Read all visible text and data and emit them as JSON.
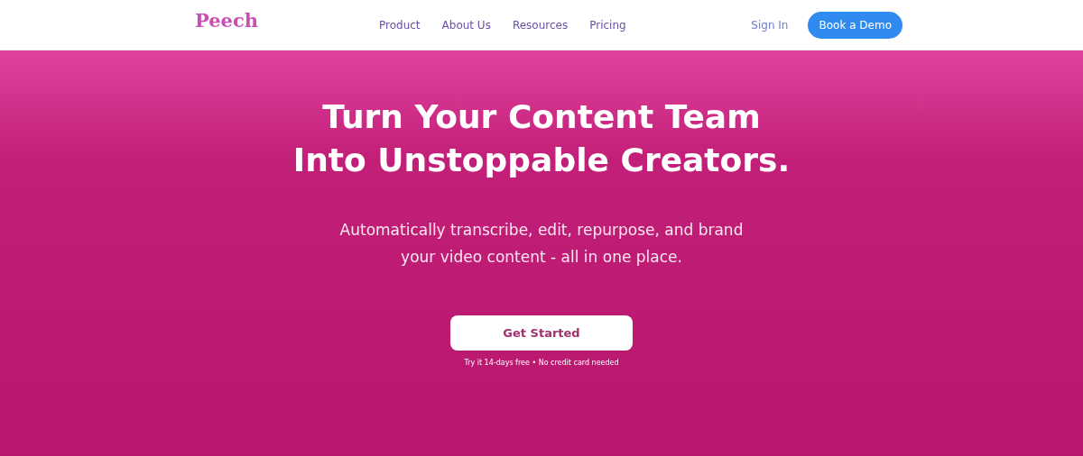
{
  "nav": {
    "logo": "Peech",
    "links": [
      {
        "label": "Product"
      },
      {
        "label": "About Us"
      },
      {
        "label": "Resources"
      },
      {
        "label": "Pricing"
      }
    ],
    "sign_in": "Sign In",
    "cta": "Book a Demo"
  },
  "hero": {
    "headline": [
      "Turn Your Content Team",
      "Into Unstoppable Creators."
    ],
    "subtitle": [
      "Automatically transcribe, edit, repurpose, and brand",
      "your video content - all in one place."
    ],
    "button": "Get Started",
    "note": "Try it 14-days free • No credit card needed"
  }
}
